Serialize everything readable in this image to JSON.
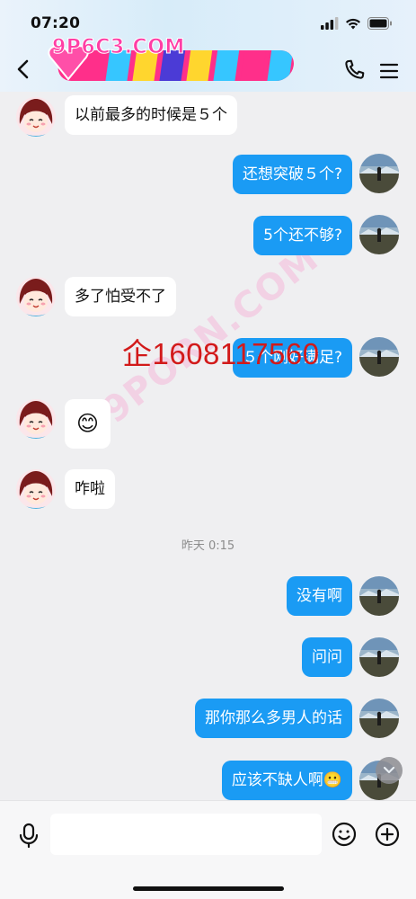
{
  "status_bar": {
    "time": "07:20"
  },
  "watermarks": {
    "logo_text": "9P6C3.COM",
    "diagonal_text": "9PORN.COM",
    "overlay_text": "企1608117560"
  },
  "messages": [
    {
      "side": "in",
      "text": "以前最多的时候是５个"
    },
    {
      "side": "out",
      "text": "还想突破５个?"
    },
    {
      "side": "out",
      "text": "5个还不够?"
    },
    {
      "side": "in",
      "text": "多了怕受不了"
    },
    {
      "side": "out",
      "text": "５个刚好满足?"
    },
    {
      "side": "in",
      "text": "😊"
    },
    {
      "side": "in",
      "text": "咋啦"
    },
    {
      "side": "out",
      "text": "没有啊"
    },
    {
      "side": "out",
      "text": "问问"
    },
    {
      "side": "out",
      "text": "那你那么多男人的话"
    },
    {
      "side": "out",
      "text": "应该不缺人啊😬"
    }
  ],
  "time_separator": "昨天 0:15",
  "input": {
    "value": "",
    "placeholder": ""
  },
  "icons": {
    "back": "chevron-left-icon",
    "call": "phone-icon",
    "menu": "menu-icon",
    "mic": "microphone-icon",
    "emoji": "smiley-icon",
    "plus": "plus-circle-icon",
    "scroll": "chevron-down-icon"
  },
  "colors": {
    "outgoing_bubble": "#1a9bf4",
    "incoming_bubble": "#ffffff",
    "background": "#efeff1",
    "overlay_red": "#d21a1a"
  }
}
